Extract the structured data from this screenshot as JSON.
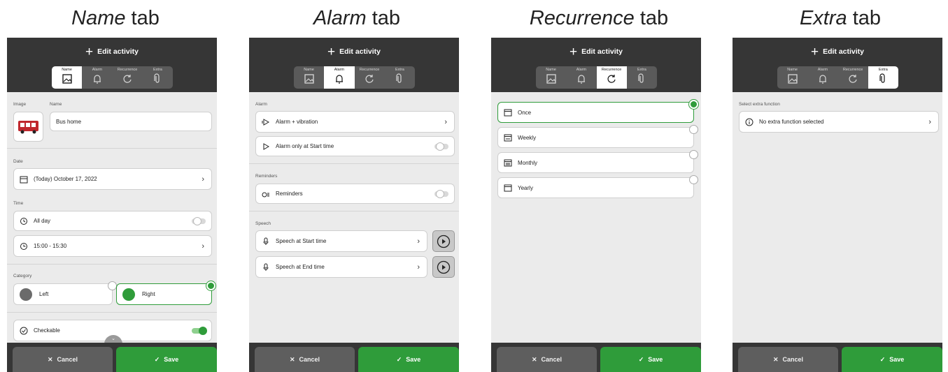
{
  "captions": {
    "name": {
      "emph": "Name",
      "rest": " tab"
    },
    "alarm": {
      "emph": "Alarm",
      "rest": " tab"
    },
    "recurrence": {
      "emph": "Recurrence",
      "rest": " tab"
    },
    "extra": {
      "emph": "Extra",
      "rest": " tab"
    }
  },
  "header": {
    "title": "Edit activity",
    "plus_icon": "plus-icon"
  },
  "tabs": [
    {
      "label": "Name",
      "icon": "image-icon"
    },
    {
      "label": "Alarm",
      "icon": "alarm-bell-icon"
    },
    {
      "label": "Recurrence",
      "icon": "recurrence-icon"
    },
    {
      "label": "Extra",
      "icon": "paperclip-icon"
    }
  ],
  "footer": {
    "cancel": "Cancel",
    "save": "Save"
  },
  "name_tab": {
    "image_label": "Image",
    "name_label": "Name",
    "name_value": "Bus home",
    "date_label": "Date",
    "date_value": "(Today) October 17, 2022",
    "time_label": "Time",
    "all_day": "All day",
    "all_day_on": false,
    "time_range": "15:00 - 15:30",
    "category_label": "Category",
    "category_left": "Left",
    "category_right": "Right",
    "category_selected": "Right",
    "checkable": "Checkable",
    "checkable_on": true,
    "colors": {
      "left_dot": "#6b6b6b",
      "right_dot": "#2f9c3a",
      "accent": "#2f9c3a"
    }
  },
  "alarm_tab": {
    "alarm_label": "Alarm",
    "alarm_value": "Alarm + vibration",
    "alarm_only_start": "Alarm only at Start time",
    "alarm_only_start_on": false,
    "reminders_label": "Reminders",
    "reminders": "Reminders",
    "reminders_on": false,
    "speech_label": "Speech",
    "speech_start": "Speech at Start time",
    "speech_end": "Speech at End time"
  },
  "recurrence_tab": {
    "options": [
      "Once",
      "Weekly",
      "Monthly",
      "Yearly"
    ],
    "selected": "Once"
  },
  "extra_tab": {
    "label": "Select extra function",
    "value": "No extra function selected"
  }
}
